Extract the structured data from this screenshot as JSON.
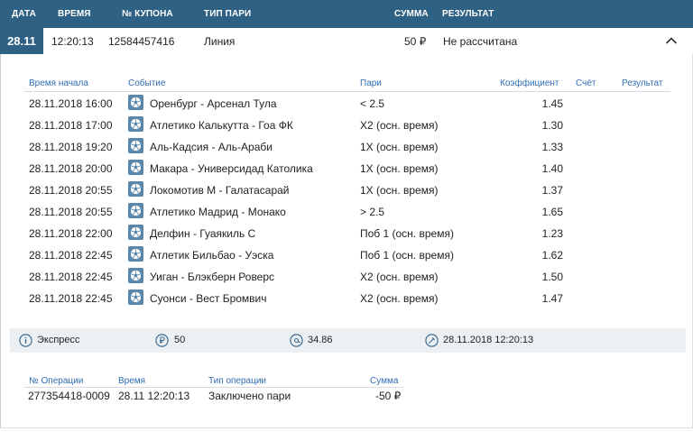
{
  "header": {
    "date": "ДАТА",
    "time": "ВРЕМЯ",
    "coupon": "№ КУПОНА",
    "bet_type": "ТИП ПАРИ",
    "sum": "СУММА",
    "result": "РЕЗУЛЬТАТ"
  },
  "coupon": {
    "date": "28.11",
    "time": "12:20:13",
    "number": "12584457416",
    "type": "Линия",
    "sum": "50 ₽",
    "status": "Не рассчитана"
  },
  "events_header": {
    "start_time": "Время начала",
    "event": "Событие",
    "bet": "Пари",
    "coefficient": "Коэффициент",
    "score": "Счёт",
    "result": "Результат"
  },
  "events": [
    {
      "time": "28.11.2018 16:00",
      "event": "Оренбург - Арсенал Тула",
      "bet": "< 2.5",
      "coef": "1.45"
    },
    {
      "time": "28.11.2018 17:00",
      "event": "Атлетико Калькутта - Гоа ФК",
      "bet": "Х2 (осн. время)",
      "coef": "1.30"
    },
    {
      "time": "28.11.2018 19:20",
      "event": "Аль-Кадсия - Аль-Араби",
      "bet": "1Х (осн. время)",
      "coef": "1.33"
    },
    {
      "time": "28.11.2018 20:00",
      "event": "Макара - Универсидад Католика",
      "bet": "1Х (осн. время)",
      "coef": "1.40"
    },
    {
      "time": "28.11.2018 20:55",
      "event": "Локомотив М - Галатасарай",
      "bet": "1Х (осн. время)",
      "coef": "1.37"
    },
    {
      "time": "28.11.2018 20:55",
      "event": "Атлетико Мадрид - Монако",
      "bet": "> 2.5",
      "coef": "1.65"
    },
    {
      "time": "28.11.2018 22:00",
      "event": "Делфин - Гуаякиль С",
      "bet": "Поб 1 (осн. время)",
      "coef": "1.23"
    },
    {
      "time": "28.11.2018 22:45",
      "event": "Атлетик Бильбао - Уэска",
      "bet": "Поб 1 (осн. время)",
      "coef": "1.62"
    },
    {
      "time": "28.11.2018 22:45",
      "event": "Уиган - Блэкберн Роверс",
      "bet": "Х2 (осн. время)",
      "coef": "1.50"
    },
    {
      "time": "28.11.2018 22:45",
      "event": "Суонси - Вест Бромвич",
      "bet": "Х2 (осн. время)",
      "coef": "1.47"
    }
  ],
  "summary": {
    "kind": "Экспресс",
    "stake": "50",
    "total_coef": "34.86",
    "datetime": "28.11.2018 12:20:13"
  },
  "operations_header": {
    "number": "№ Операции",
    "time": "Время",
    "type": "Тип операции",
    "sum": "Сумма"
  },
  "operations": [
    {
      "number": "277354418-0009",
      "time": "28.11 12:20:13",
      "type": "Заключено пари",
      "sum": "-50 ₽"
    }
  ],
  "colors": {
    "header_bg": "#2e6183",
    "link_blue": "#2e6db5",
    "sport_icon_bg": "#5a86a9",
    "summary_bg": "#edf0f3"
  },
  "icons": {
    "sport": "soccer-ball-icon",
    "kind": "info-icon",
    "stake": "ruble-coin-icon",
    "coef": "at-sign-icon",
    "datetime": "calendar-clock-icon",
    "toggle": "chevron-up-icon"
  }
}
